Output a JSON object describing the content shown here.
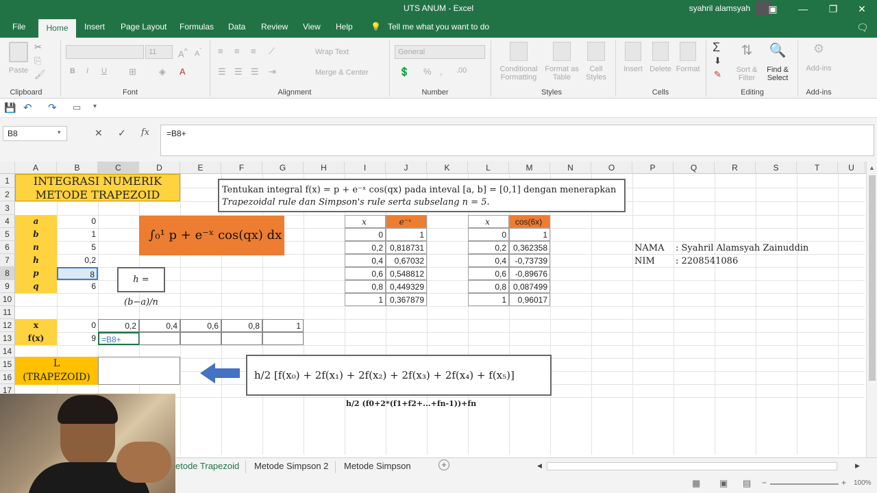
{
  "window": {
    "title": "UTS ANUM  -  Excel",
    "user": "syahril alamsyah"
  },
  "tabs": [
    "File",
    "Home",
    "Insert",
    "Page Layout",
    "Formulas",
    "Data",
    "Review",
    "View",
    "Help"
  ],
  "tell_me": "Tell me what you want to do",
  "ribbon": {
    "clipboard": {
      "paste": "Paste",
      "label": "Clipboard"
    },
    "font": {
      "label": "Font",
      "size": "11",
      "bold": "B",
      "italic": "I",
      "underline": "U"
    },
    "alignment": {
      "label": "Alignment",
      "wrap": "Wrap Text",
      "merge": "Merge & Center"
    },
    "number": {
      "label": "Number",
      "format": "General"
    },
    "styles": {
      "label": "Styles",
      "cond1": "Conditional",
      "cond2": "Formatting",
      "fmt1": "Format as",
      "fmt2": "Table",
      "cell1": "Cell",
      "cell2": "Styles"
    },
    "cells": {
      "label": "Cells",
      "insert": "Insert",
      "delete": "Delete",
      "format": "Format"
    },
    "editing": {
      "label": "Editing",
      "sort1": "Sort &",
      "sort2": "Filter",
      "find1": "Find &",
      "find2": "Select"
    },
    "addins": {
      "label": "Add-ins",
      "addins": "Add-ins"
    }
  },
  "formula_bar": {
    "name_box": "B8",
    "formula": "=B8+"
  },
  "columns": [
    "A",
    "B",
    "C",
    "D",
    "E",
    "F",
    "G",
    "H",
    "I",
    "J",
    "K",
    "L",
    "M",
    "N",
    "O",
    "P",
    "Q",
    "R",
    "S",
    "T",
    "U"
  ],
  "rows": [
    "1",
    "2",
    "3",
    "4",
    "5",
    "6",
    "7",
    "8",
    "9",
    "10",
    "11",
    "12",
    "13",
    "14",
    "15",
    "16",
    "17"
  ],
  "sheet": {
    "title1": "INTEGRASI NUMERIK",
    "title2": "METODE TRAPEZOID",
    "params": [
      {
        "name": "a",
        "value": "0"
      },
      {
        "name": "b",
        "value": "1"
      },
      {
        "name": "n",
        "value": "5"
      },
      {
        "name": "h",
        "value": "0,2"
      },
      {
        "name": "p",
        "value": "8"
      },
      {
        "name": "q",
        "value": "6"
      }
    ],
    "problem_line1": "Tentukan  integral  f(x) = p + e⁻ˣ cos(qx)  pada  inteval  [a, b] = [0,1]  dengan  menerapkan",
    "problem_line2": "Trapezoidal rule  dan Simpson's rule serta subselang n = 5.",
    "integral_text": "∫₀¹ p + e⁻ˣ cos(qx) dx",
    "h_formula": "h = (b−a)/n",
    "exp_table": {
      "hdr_x": "x",
      "hdr_f": "e⁻ˣ",
      "rows": [
        [
          "0",
          "1"
        ],
        [
          "0,2",
          "0,818731"
        ],
        [
          "0,4",
          "0,67032"
        ],
        [
          "0,6",
          "0,548812"
        ],
        [
          "0,8",
          "0,449329"
        ],
        [
          "1",
          "0,367879"
        ]
      ]
    },
    "cos_table": {
      "hdr_x": "x",
      "hdr_f": "cos(6x)",
      "rows": [
        [
          "0",
          "1"
        ],
        [
          "0,2",
          "0,362358"
        ],
        [
          "0,4",
          "-0,73739"
        ],
        [
          "0,6",
          "-0,89676"
        ],
        [
          "0,8",
          "0,087499"
        ],
        [
          "1",
          "0,96017"
        ]
      ]
    },
    "name_label": "NAMA",
    "name_value": ": Syahril Alamsyah Zainuddin",
    "nim_label": "NIM",
    "nim_value": ": 2208541086",
    "x_row": {
      "label": "x",
      "values": [
        "0",
        "0,2",
        "0,4",
        "0,6",
        "0,8",
        "1"
      ]
    },
    "fx_row": {
      "label": "f(x)",
      "value": "9",
      "editing": "=B8+"
    },
    "L_label1": "L",
    "L_label2": "(TRAPEZOID)",
    "trap_formula": "h/2 [f(x₀) + 2f(x₁) + 2f(x₂) + 2f(x₃) + 2f(x₄) + f(x₅)]",
    "trap_text": "h/2 (f0+2*(f1+f2+...+fn-1))+fn"
  },
  "sheet_tabs": [
    "etode Trapezoid",
    "Metode Simpson 2",
    "Metode Simpson"
  ],
  "status": {
    "zoom": "100%"
  },
  "colors": {
    "excel_green": "#217346",
    "yellow": "#ffd23f",
    "orange": "#ed7d31",
    "arrow": "#4472c4"
  }
}
